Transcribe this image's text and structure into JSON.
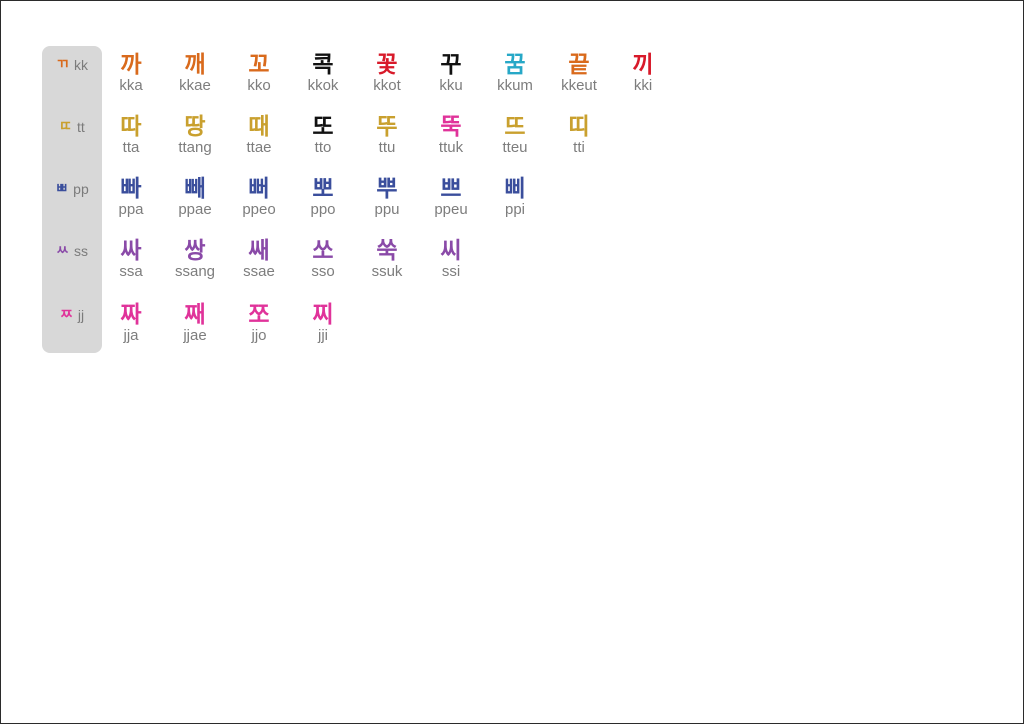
{
  "colors": {
    "kk": "#d96a1c",
    "tt": "#c9a02e",
    "pp": "#3a4e9c",
    "ss": "#8a4aa8",
    "jj": "#e0339a",
    "black": "#111111",
    "teal": "#27a8c7",
    "red": "#d81a2a"
  },
  "rows": [
    {
      "key": "kk",
      "label_jamo": "ㄲ",
      "label_roman": "kk",
      "items": [
        {
          "syl": "까",
          "roman": "kka"
        },
        {
          "syl": "깨",
          "roman": "kkae"
        },
        {
          "syl": "꼬",
          "roman": "kko"
        },
        {
          "syl": "콕",
          "roman": "kkok"
        },
        {
          "syl": "꽃",
          "roman": "kkot"
        },
        {
          "syl": "꾸",
          "roman": "kku"
        },
        {
          "syl": "꿈",
          "roman": "kkum"
        },
        {
          "syl": "끝",
          "roman": "kkeut"
        },
        {
          "syl": "끼",
          "roman": "kki"
        }
      ]
    },
    {
      "key": "tt",
      "label_jamo": "ㄸ",
      "label_roman": "tt",
      "items": [
        {
          "syl": "따",
          "roman": "tta"
        },
        {
          "syl": "땅",
          "roman": "ttang"
        },
        {
          "syl": "때",
          "roman": "ttae"
        },
        {
          "syl": "또",
          "roman": "tto"
        },
        {
          "syl": "뚜",
          "roman": "ttu"
        },
        {
          "syl": "뚝",
          "roman": "ttuk"
        },
        {
          "syl": "뜨",
          "roman": "tteu"
        },
        {
          "syl": "띠",
          "roman": "tti"
        }
      ]
    },
    {
      "key": "pp",
      "label_jamo": "ㅃ",
      "label_roman": "pp",
      "items": [
        {
          "syl": "빠",
          "roman": "ppa"
        },
        {
          "syl": "빼",
          "roman": "ppae"
        },
        {
          "syl": "뻐",
          "roman": "ppeo"
        },
        {
          "syl": "뽀",
          "roman": "ppo"
        },
        {
          "syl": "뿌",
          "roman": "ppu"
        },
        {
          "syl": "쁘",
          "roman": "ppeu"
        },
        {
          "syl": "삐",
          "roman": "ppi"
        }
      ]
    },
    {
      "key": "ss",
      "label_jamo": "ㅆ",
      "label_roman": "ss",
      "items": [
        {
          "syl": "싸",
          "roman": "ssa"
        },
        {
          "syl": "쌍",
          "roman": "ssang"
        },
        {
          "syl": "쌔",
          "roman": "ssae"
        },
        {
          "syl": "쏘",
          "roman": "sso"
        },
        {
          "syl": "쑥",
          "roman": "ssuk"
        },
        {
          "syl": "씨",
          "roman": "ssi"
        }
      ]
    },
    {
      "key": "jj",
      "label_jamo": "ㅉ",
      "label_roman": "jj",
      "items": [
        {
          "syl": "짜",
          "roman": "jja"
        },
        {
          "syl": "째",
          "roman": "jjae"
        },
        {
          "syl": "쪼",
          "roman": "jjo"
        },
        {
          "syl": "찌",
          "roman": "jji"
        }
      ]
    }
  ]
}
